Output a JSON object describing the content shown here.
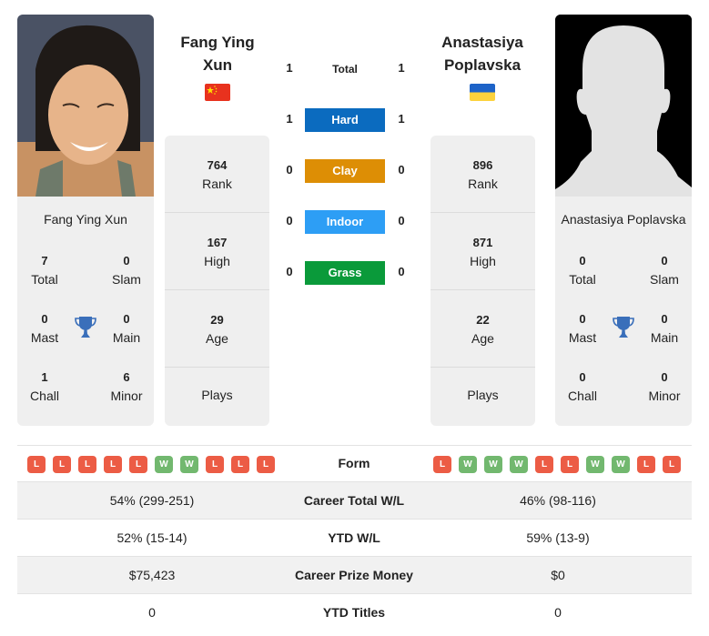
{
  "player_left": {
    "name": "Fang Ying Xun",
    "name_line1": "Fang Ying",
    "name_line2": "Xun",
    "country_flag": "china-flag",
    "photo": "player-photo",
    "rank": "764",
    "rank_label": "Rank",
    "high": "167",
    "high_label": "High",
    "age": "29",
    "age_label": "Age",
    "plays_label": "Plays",
    "titles": {
      "total": "7",
      "total_label": "Total",
      "slam": "0",
      "slam_label": "Slam",
      "mast": "0",
      "mast_label": "Mast",
      "main": "0",
      "main_label": "Main",
      "chall": "1",
      "chall_label": "Chall",
      "minor": "6",
      "minor_label": "Minor"
    },
    "form": [
      "L",
      "L",
      "L",
      "L",
      "L",
      "W",
      "W",
      "L",
      "L",
      "L"
    ]
  },
  "player_right": {
    "name": "Anastasiya Poplavska",
    "name_line1": "Anastasiya",
    "name_line2": "Poplavska",
    "country_flag": "ukraine-flag",
    "photo": "placeholder-silhouette",
    "rank": "896",
    "rank_label": "Rank",
    "high": "871",
    "high_label": "High",
    "age": "22",
    "age_label": "Age",
    "plays_label": "Plays",
    "titles": {
      "total": "0",
      "total_label": "Total",
      "slam": "0",
      "slam_label": "Slam",
      "mast": "0",
      "mast_label": "Mast",
      "main": "0",
      "main_label": "Main",
      "chall": "0",
      "chall_label": "Chall",
      "minor": "0",
      "minor_label": "Minor"
    },
    "form": [
      "L",
      "W",
      "W",
      "W",
      "L",
      "L",
      "W",
      "W",
      "L",
      "L"
    ]
  },
  "h2h": [
    {
      "label": "Total",
      "left": "1",
      "right": "1",
      "color": ""
    },
    {
      "label": "Hard",
      "left": "1",
      "right": "1",
      "color": "#0b6bbf"
    },
    {
      "label": "Clay",
      "left": "0",
      "right": "0",
      "color": "#dd8e05"
    },
    {
      "label": "Indoor",
      "left": "0",
      "right": "0",
      "color": "#2d9ef5"
    },
    {
      "label": "Grass",
      "left": "0",
      "right": "0",
      "color": "#0a9a3a"
    }
  ],
  "form_label": "Form",
  "comparison": [
    {
      "label": "Career Total W/L",
      "left": "54% (299-251)",
      "right": "46% (98-116)"
    },
    {
      "label": "YTD W/L",
      "left": "52% (15-14)",
      "right": "59% (13-9)"
    },
    {
      "label": "Career Prize Money",
      "left": "$75,423",
      "right": "$0"
    },
    {
      "label": "YTD Titles",
      "left": "0",
      "right": "0"
    }
  ],
  "colors": {
    "loss": "#ec5c45",
    "win": "#72b86f",
    "trophy": "#3a6fba",
    "card_bg": "#efefef"
  }
}
